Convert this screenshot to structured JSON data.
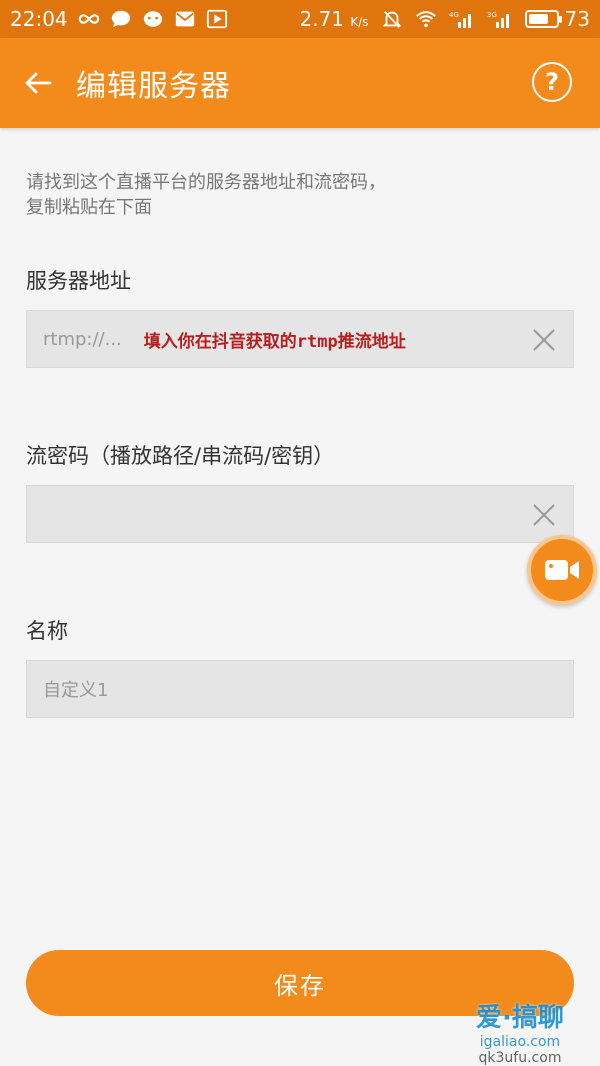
{
  "status_bar": {
    "time": "22:04",
    "net_speed": "2.71",
    "net_unit": "K/s",
    "signal_1": "4G",
    "signal_2": "3G",
    "battery": "73",
    "battery_level_percent": 73
  },
  "app_bar": {
    "title": "编辑服务器",
    "help_label": "?"
  },
  "instruction": {
    "line1": "请找到这个直播平台的服务器地址和流密码，",
    "line2": "复制粘贴在下面"
  },
  "fields": {
    "server": {
      "label": "服务器地址",
      "value": "rtmp://...",
      "annotation": "填入你在抖音获取的rtmp推流地址"
    },
    "stream_key": {
      "label": "流密码（播放路径/串流码/密钥）",
      "value": ""
    },
    "name": {
      "label": "名称",
      "value": "自定义1"
    }
  },
  "save_label": "保存",
  "watermark": {
    "main": "爱·搞聊",
    "sub": "igaliao.com",
    "sub2": "qk3ufu.com"
  },
  "colors": {
    "status_bar": "#e0740d",
    "app_bar": "#f28a1c",
    "accent": "#f28a1c",
    "annotation": "#b81e1e"
  }
}
